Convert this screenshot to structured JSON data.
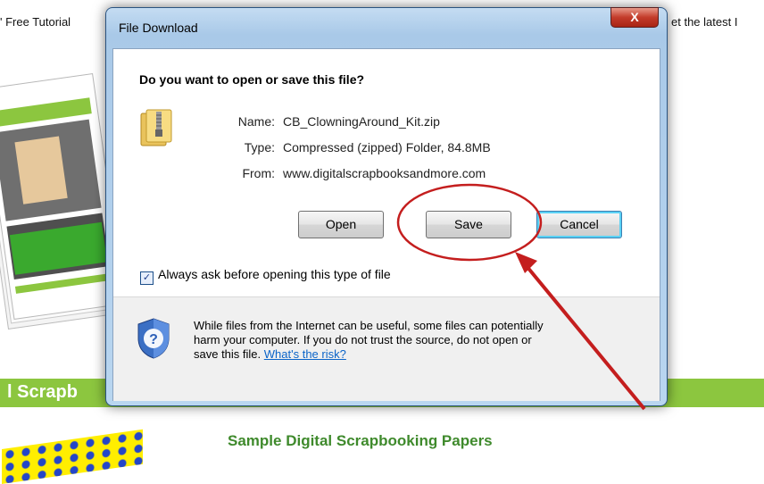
{
  "background": {
    "left_text": "' Free Tutorial",
    "right_text": "et the latest I",
    "banner_text": "l Scrapb",
    "subheading": "Sample Digital Scrapbooking Papers"
  },
  "dialog": {
    "title": "File Download",
    "close_label": "X",
    "question": "Do you want to open or save this file?",
    "file": {
      "name_label": "Name:",
      "name_value": "CB_ClowningAround_Kit.zip",
      "type_label": "Type:",
      "type_value": "Compressed (zipped) Folder, 84.8MB",
      "from_label": "From:",
      "from_value": "www.digitalscrapbooksandmore.com"
    },
    "buttons": {
      "open": "Open",
      "save": "Save",
      "cancel": "Cancel"
    },
    "checkbox": {
      "label": "Always ask before opening this type of file",
      "checked": true,
      "mark": "✓"
    },
    "warning": {
      "line1": "While files from the Internet can be useful, some files can potentially",
      "line2": "harm your computer. If you do not trust the source, do not open or",
      "line3": "save this file.",
      "link": "What's the risk?"
    }
  },
  "annotation": {
    "color": "#c41e1e"
  },
  "colors": {
    "banner": "#8cc63f",
    "subheading": "#3f8a2c",
    "link": "#0b64c8"
  }
}
